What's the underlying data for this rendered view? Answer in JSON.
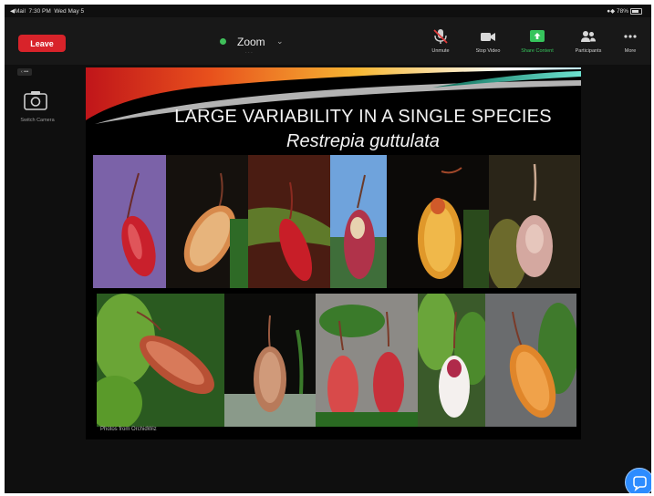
{
  "status_bar": {
    "carrier": "Mail",
    "time": "7:30 PM",
    "date": "Wed May 5",
    "battery": "78%"
  },
  "toolbar": {
    "leave_label": "Leave",
    "meeting_name": "Zoom",
    "meeting_sub": "· · ·",
    "buttons": [
      {
        "label": "Unmute",
        "icon": "microphone-muted-icon"
      },
      {
        "label": "Stop Video",
        "icon": "video-camera-icon"
      },
      {
        "label": "Share Content",
        "icon": "share-screen-icon"
      },
      {
        "label": "Participants",
        "icon": "participants-icon"
      },
      {
        "label": "More",
        "icon": "more-icon"
      }
    ]
  },
  "side_panel": {
    "badge": "‹ •••",
    "camera_label": "Switch Camera"
  },
  "slide": {
    "title": "LARGE VARIABILITY IN A SINGLE SPECIES",
    "subtitle": "Restrepia guttulata",
    "credit": "Photos from OrchidWiz",
    "photos": [
      "orchid-photo",
      "orchid-photo",
      "orchid-photo",
      "orchid-photo",
      "orchid-photo",
      "orchid-photo",
      "orchid-photo",
      "orchid-photo",
      "orchid-photo",
      "orchid-photo",
      "orchid-photo"
    ]
  },
  "colors": {
    "leave": "#d8232a",
    "share_active": "#36c45c",
    "chat_bubble": "#2d8cff",
    "background": "#0f0f0f"
  }
}
